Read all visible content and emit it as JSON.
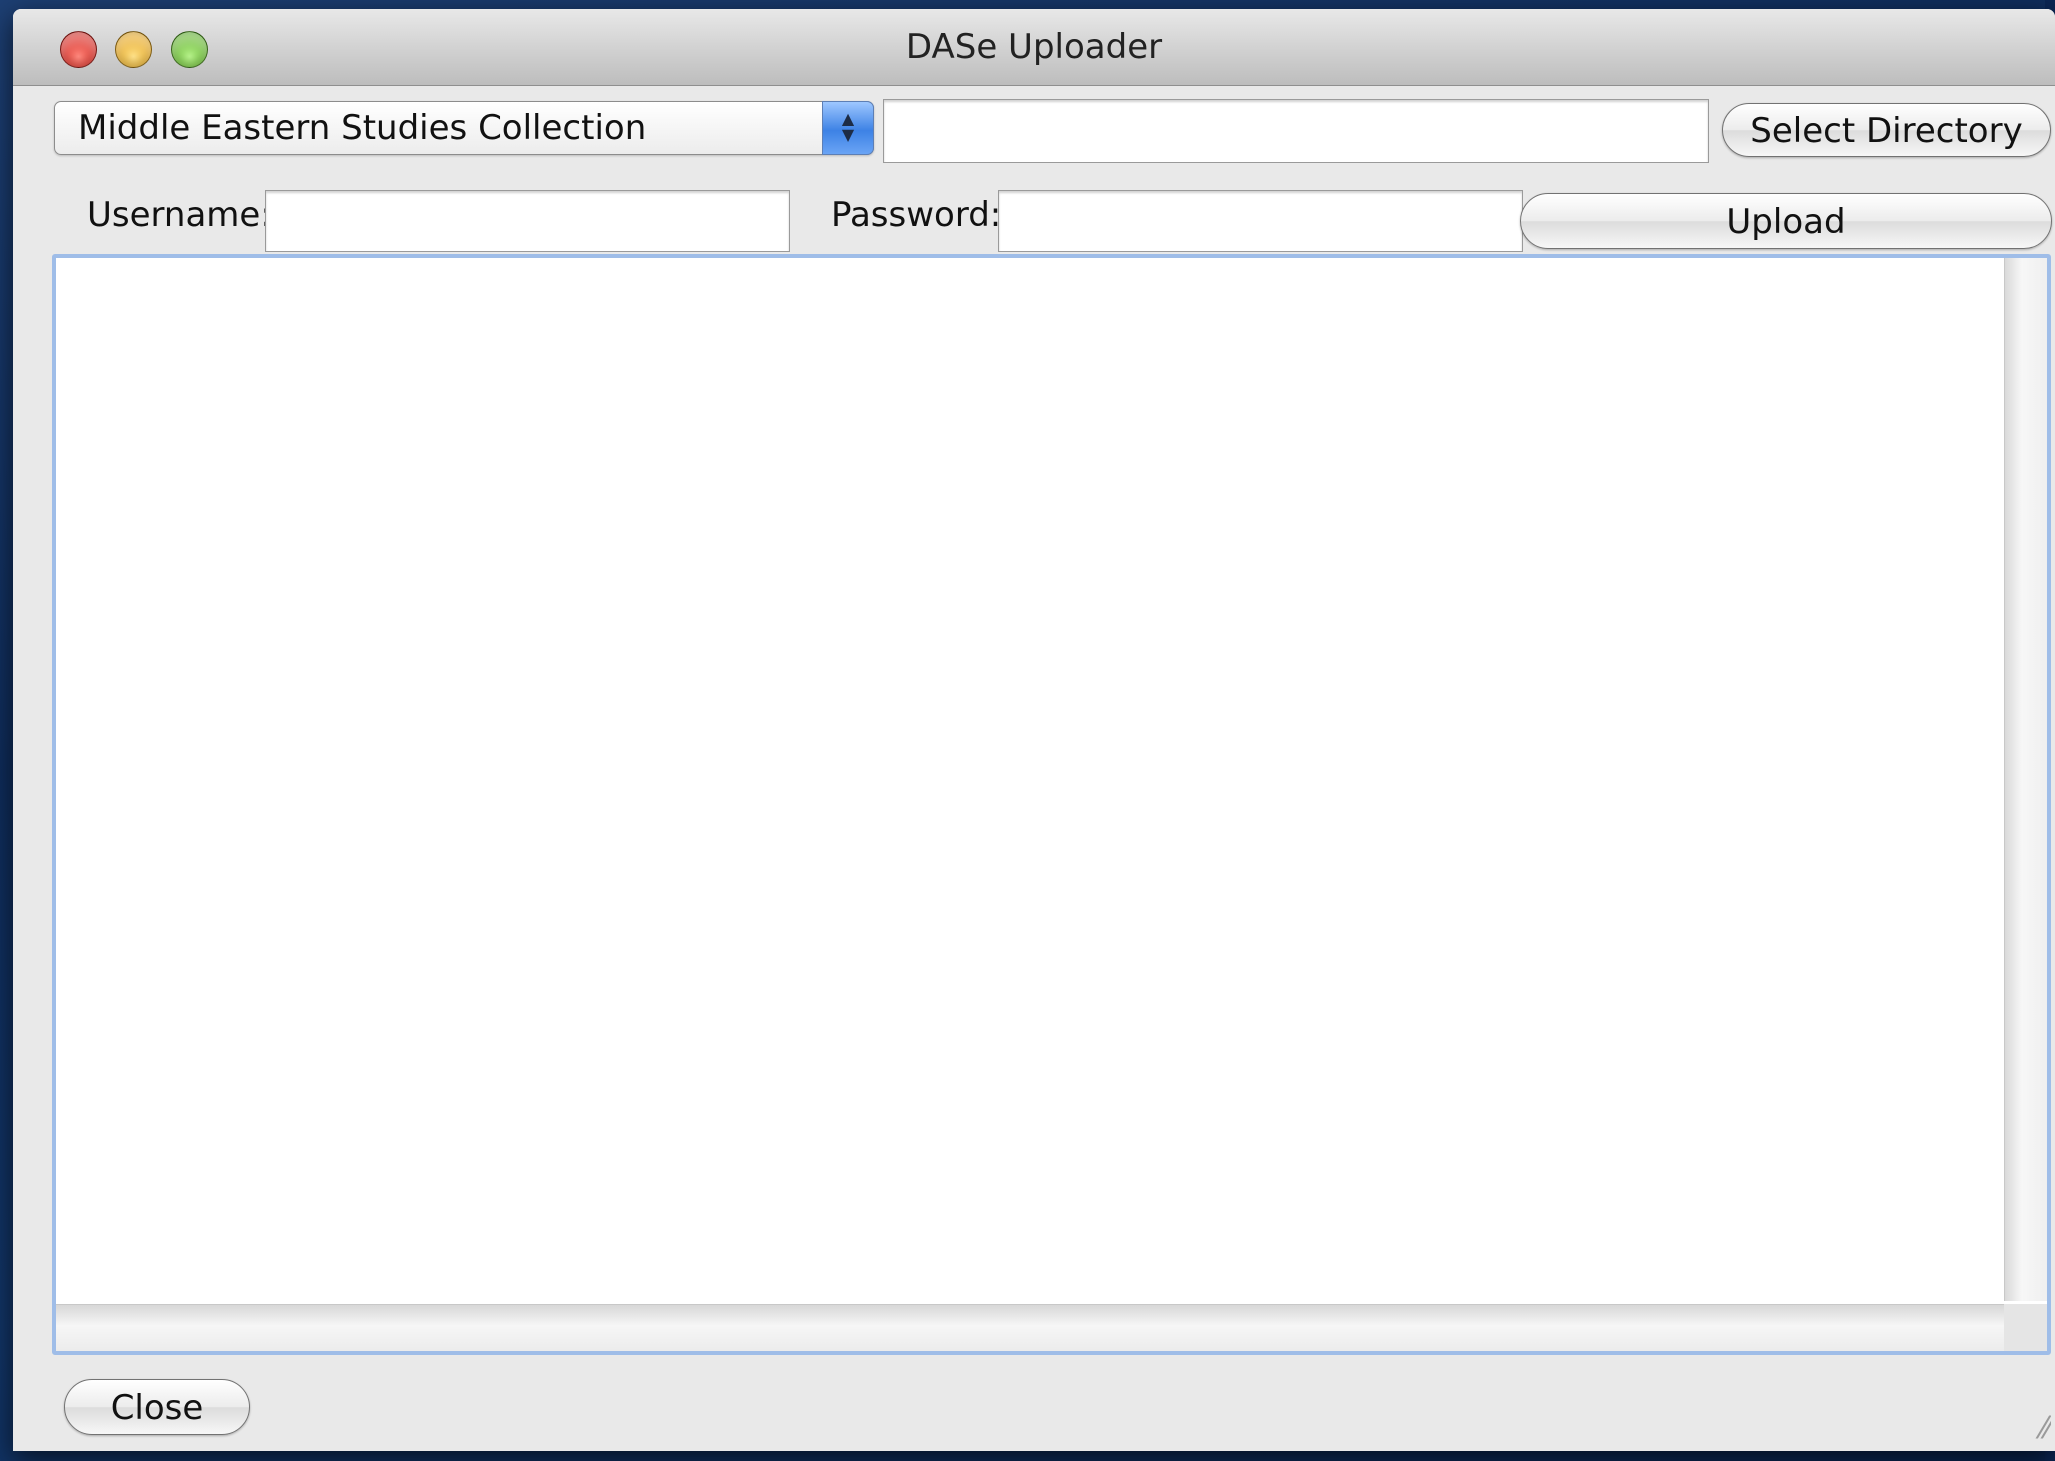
{
  "window": {
    "title": "DASe Uploader"
  },
  "collection_select": {
    "selected": "Middle Eastern Studies Collection",
    "stepper_icon": "up-down-arrows"
  },
  "directory": {
    "value": "",
    "button_label": "Select Directory"
  },
  "credentials": {
    "username_label": "Username:",
    "username_value": "",
    "password_label": "Password:",
    "password_value": ""
  },
  "actions": {
    "upload_label": "Upload",
    "close_label": "Close"
  },
  "log": {
    "text": ""
  },
  "colors": {
    "close_button": "#d7251d",
    "minimize_button": "#e5a51d",
    "zoom_button": "#62b52b",
    "focus_ring": "#9fbde8",
    "window_bg": "#e9e9e9"
  }
}
